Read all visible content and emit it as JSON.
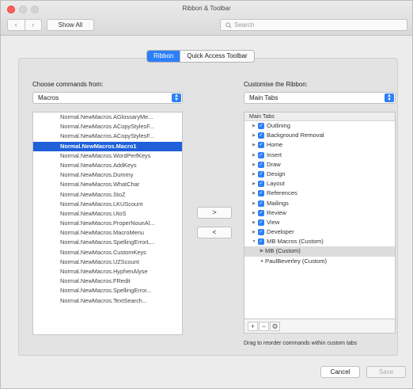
{
  "window": {
    "title": "Ribbon & Toolbar"
  },
  "toolbar": {
    "back": "‹",
    "forward": "›",
    "show_all": "Show All",
    "search_placeholder": "Search"
  },
  "tabs": [
    {
      "label": "Ribbon",
      "active": true
    },
    {
      "label": "Quick Access Toolbar",
      "active": false
    }
  ],
  "left": {
    "label": "Choose commands from:",
    "select_value": "Macros",
    "items": [
      "Normal.NewMacros.AGlossaryMe...",
      "Normal.NewMacros.ACopyStylesF...",
      "Normal.NewMacros.ACopyStylesF...",
      "Normal.NewMacros.Macro1",
      "Normal.NewMacros.WordPerfKeys",
      "Normal.NewMacros.AddKeys",
      "Normal.NewMacros.Dummy",
      "Normal.NewMacros.WhatChar",
      "Normal.NewMacros.StoZ",
      "Normal.NewMacros.LKUScount",
      "Normal.NewMacros.UtoS",
      "Normal.NewMacros.ProperNounAl...",
      "Normal.NewMacros.MacroMenu",
      "Normal.NewMacros.SpellingErrorL...",
      "Normal.NewMacros.CustomKeys",
      "Normal.NewMacros.UZScount",
      "Normal.NewMacros.HyphenAlyse",
      "Normal.NewMacros.FRedit",
      "Normal.NewMacros.SpellingError...",
      "Normal.NewMacros.TextSearch..."
    ],
    "selected_index": 3
  },
  "move": {
    "add": ">",
    "remove": "<"
  },
  "right": {
    "label": "Customise the Ribbon:",
    "select_value": "Main Tabs",
    "tree_header": "Main Tabs",
    "tabs": [
      "Outlining",
      "Background Removal",
      "Home",
      "Insert",
      "Draw",
      "Design",
      "Layout",
      "References",
      "Mailings",
      "Review",
      "View",
      "Developer",
      "MB Macros (Custom)"
    ],
    "children": [
      {
        "label": "MB (Custom)",
        "selected": true
      },
      {
        "label": "PaulBeverley (Custom)",
        "selected": false
      }
    ],
    "footer": {
      "add": "+",
      "remove": "−",
      "options": "⚙"
    },
    "hint": "Drag to reorder commands within custom tabs"
  },
  "buttons": {
    "cancel": "Cancel",
    "save": "Save"
  }
}
